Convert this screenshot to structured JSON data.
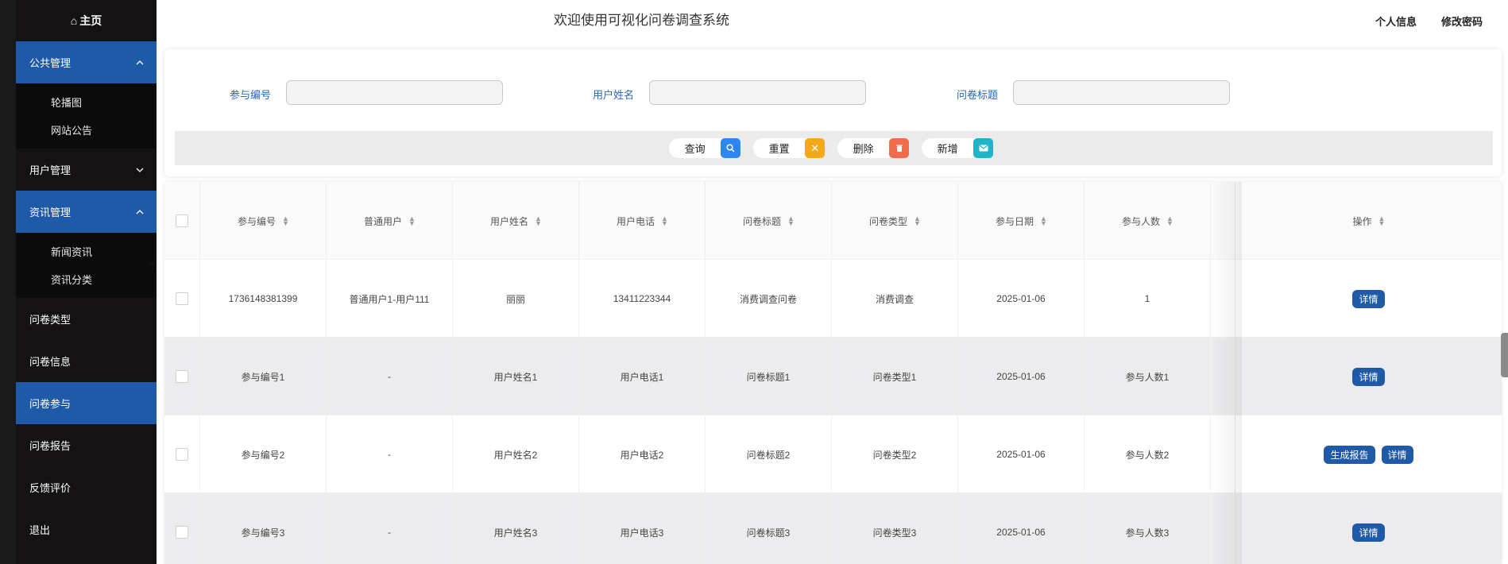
{
  "sidebar": {
    "home": "主页",
    "groups": [
      {
        "label": "公共管理",
        "expanded": true,
        "items": [
          "轮播图",
          "网站公告"
        ]
      },
      {
        "label": "用户管理",
        "expanded": false,
        "items": []
      },
      {
        "label": "资讯管理",
        "expanded": true,
        "items": [
          "新闻资讯",
          "资讯分类"
        ]
      }
    ],
    "items": [
      "问卷类型",
      "问卷信息",
      "问卷参与",
      "问卷报告",
      "反馈评价",
      "退出"
    ],
    "active_item": "问卷参与"
  },
  "header": {
    "title": "欢迎使用可视化问卷调查系统",
    "profile": "个人信息",
    "change_password": "修改密码"
  },
  "search": {
    "fields": [
      {
        "label": "参与编号",
        "value": "",
        "placeholder": ""
      },
      {
        "label": "用户姓名",
        "value": "",
        "placeholder": ""
      },
      {
        "label": "问卷标题",
        "value": "",
        "placeholder": ""
      }
    ],
    "buttons": [
      {
        "label": "查询",
        "icon": "search-icon",
        "color": "#2e86f0"
      },
      {
        "label": "重置",
        "icon": "close-icon",
        "color": "#f5a91a"
      },
      {
        "label": "删除",
        "icon": "trash-icon",
        "color": "#f26b4a"
      },
      {
        "label": "新增",
        "icon": "mail-icon",
        "color": "#1eb5c9"
      }
    ]
  },
  "table": {
    "columns": [
      "参与编号",
      "普通用户",
      "用户姓名",
      "用户电话",
      "问卷标题",
      "问卷类型",
      "参与日期",
      "参与人数",
      "操作"
    ],
    "rows": [
      {
        "cells": [
          "1736148381399",
          "普通用户1-用户111",
          "丽丽",
          "13411223344",
          "消费调查问卷",
          "消费调查",
          "2025-01-06",
          "1"
        ],
        "actions": [
          "详情"
        ]
      },
      {
        "cells": [
          "参与编号1",
          "-",
          "用户姓名1",
          "用户电话1",
          "问卷标题1",
          "问卷类型1",
          "2025-01-06",
          "参与人数1"
        ],
        "actions": [
          "详情"
        ]
      },
      {
        "cells": [
          "参与编号2",
          "-",
          "用户姓名2",
          "用户电话2",
          "问卷标题2",
          "问卷类型2",
          "2025-01-06",
          "参与人数2"
        ],
        "actions": [
          "生成报告",
          "详情"
        ]
      },
      {
        "cells": [
          "参与编号3",
          "-",
          "用户姓名3",
          "用户电话3",
          "问卷标题3",
          "问卷类型3",
          "2025-01-06",
          "参与人数3"
        ],
        "actions": [
          "详情"
        ]
      }
    ]
  },
  "colors": {
    "accent": "#1f5aa8",
    "sidebar_bg": "#141212",
    "label_blue": "#2a66b0"
  }
}
